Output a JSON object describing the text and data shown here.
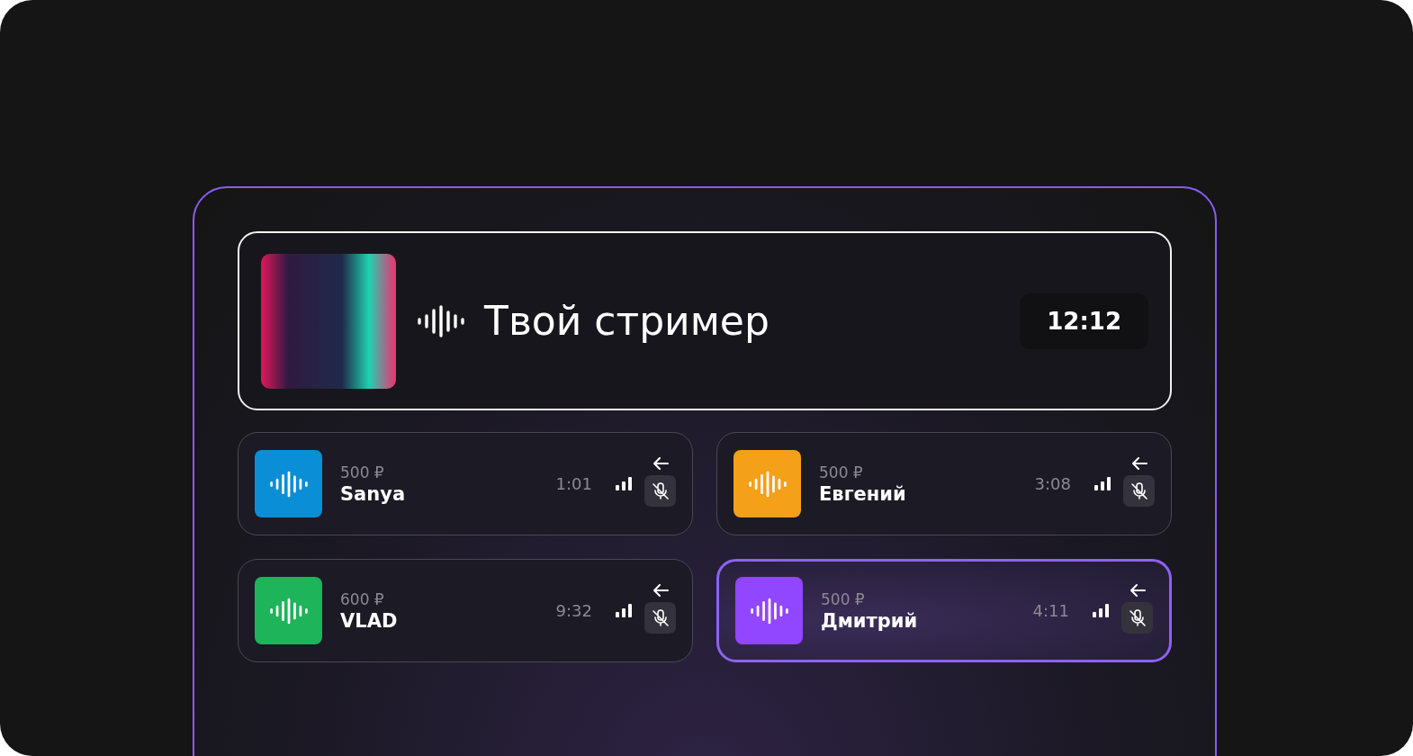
{
  "streamer": {
    "title": "Твой стример",
    "time": "12:12"
  },
  "donors": [
    {
      "amount": "500 ₽",
      "name": "Sanya",
      "time": "1:01",
      "color": "#0a8fd6",
      "selected": false
    },
    {
      "amount": "500 ₽",
      "name": "Евгений",
      "time": "3:08",
      "color": "#f5a019",
      "selected": false
    },
    {
      "amount": "600 ₽",
      "name": "VLAD",
      "time": "9:32",
      "color": "#1db45a",
      "selected": false
    },
    {
      "amount": "500 ₽",
      "name": "Дмитрий",
      "time": "4:11",
      "color": "#9146ff",
      "selected": true
    }
  ]
}
